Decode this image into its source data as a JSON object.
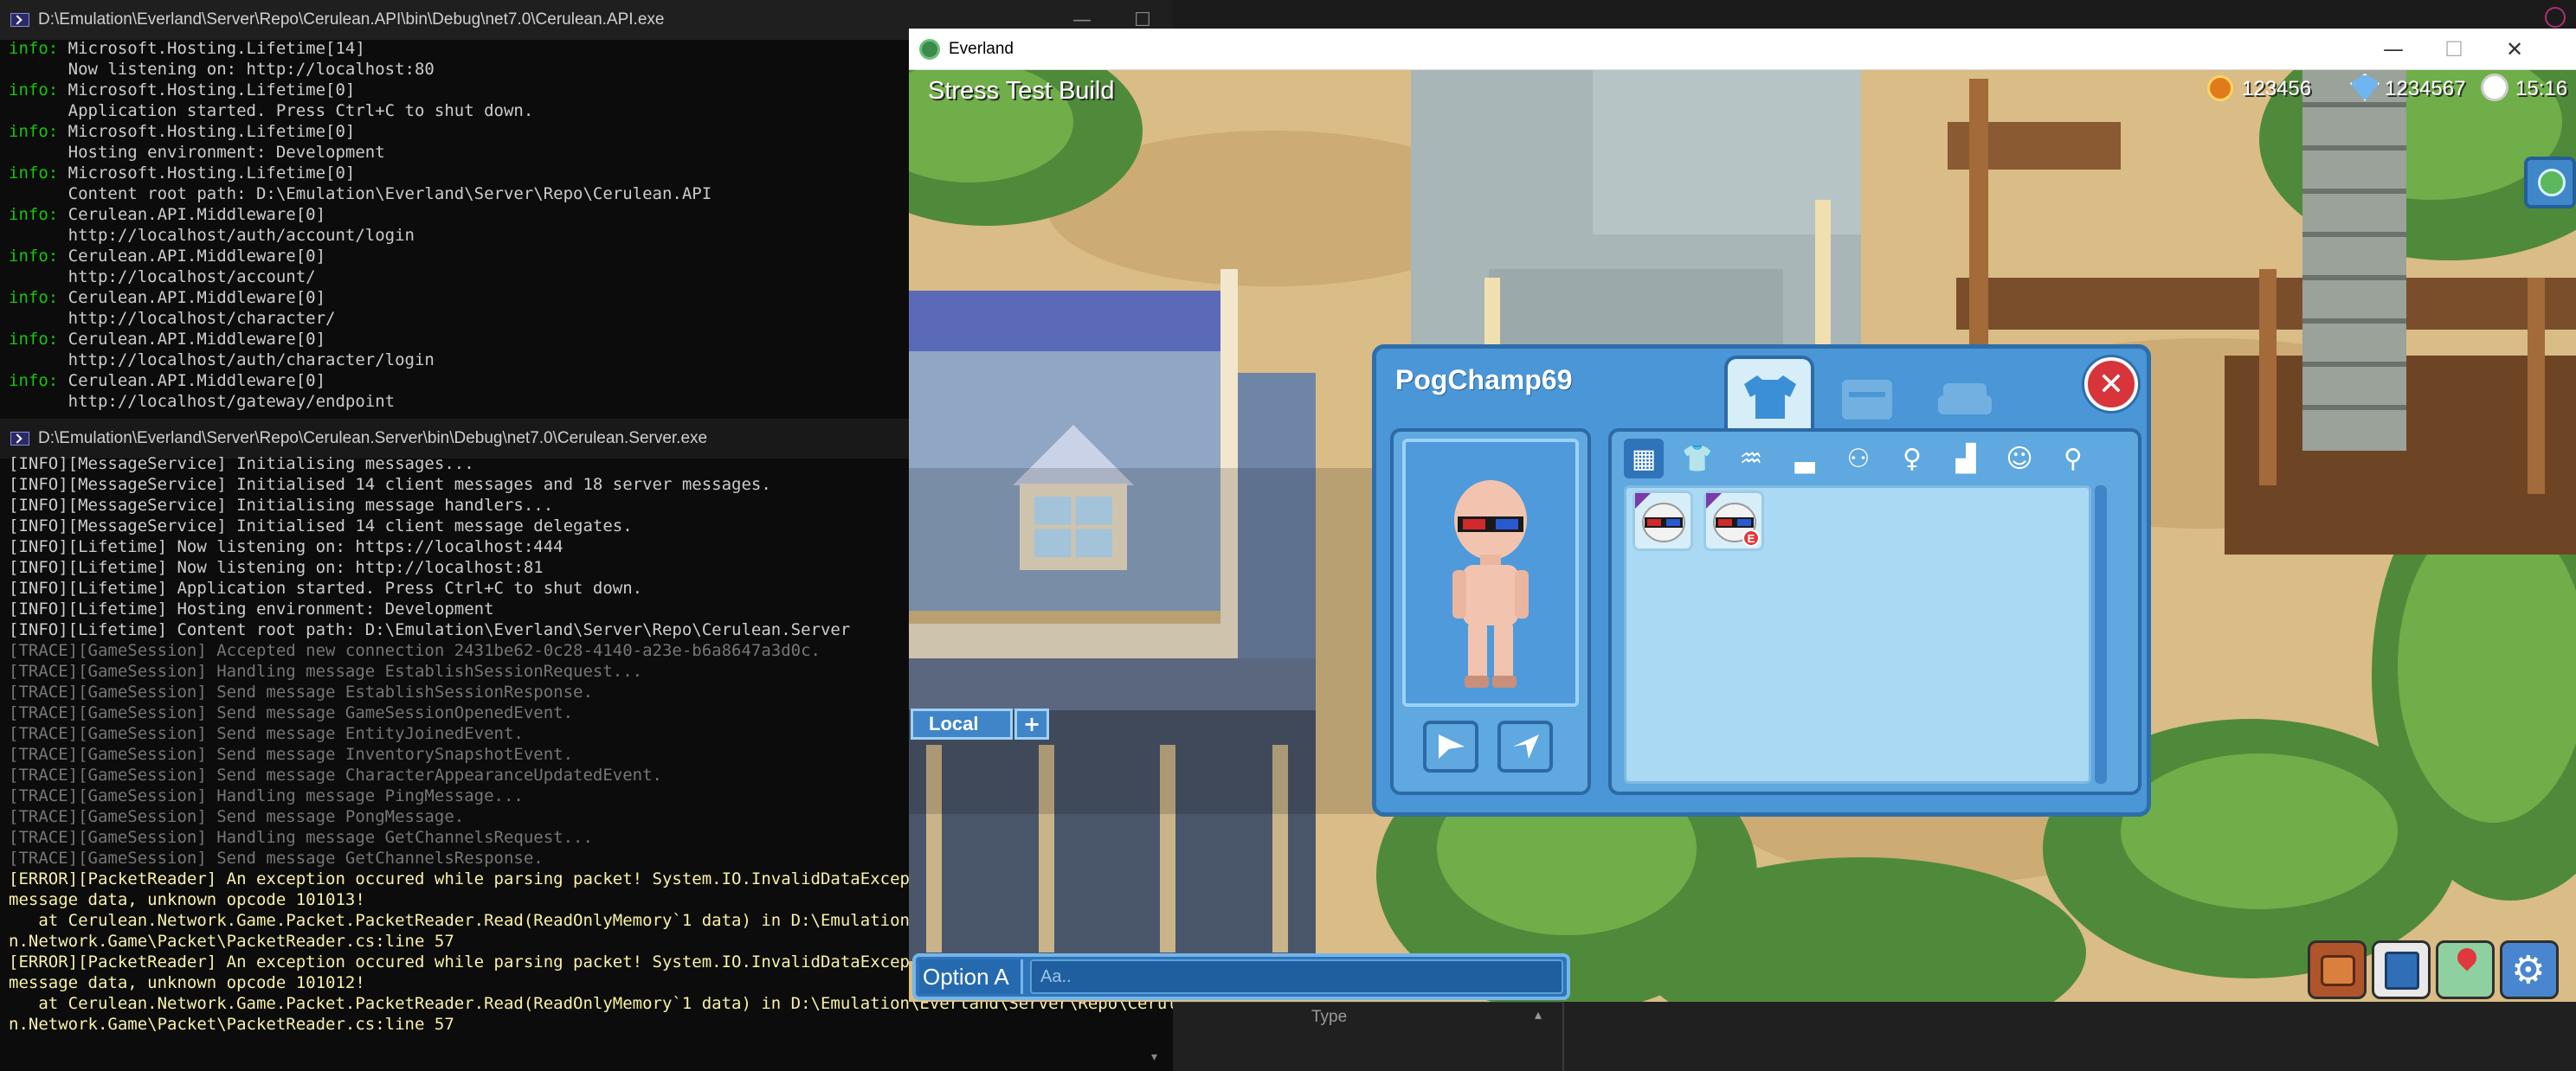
{
  "api_console": {
    "title": "D:\\Emulation\\Everland\\Server\\Repo\\Cerulean.API\\bin\\Debug\\net7.0\\Cerulean.API.exe",
    "lines": [
      {
        "tag": "info:",
        "text": " Microsoft.Hosting.Lifetime[14]"
      },
      {
        "tag": "",
        "text": "      Now listening on: http://localhost:80"
      },
      {
        "tag": "info:",
        "text": " Microsoft.Hosting.Lifetime[0]"
      },
      {
        "tag": "",
        "text": "      Application started. Press Ctrl+C to shut down."
      },
      {
        "tag": "info:",
        "text": " Microsoft.Hosting.Lifetime[0]"
      },
      {
        "tag": "",
        "text": "      Hosting environment: Development"
      },
      {
        "tag": "info:",
        "text": " Microsoft.Hosting.Lifetime[0]"
      },
      {
        "tag": "",
        "text": "      Content root path: D:\\Emulation\\Everland\\Server\\Repo\\Cerulean.API"
      },
      {
        "tag": "info:",
        "text": " Cerulean.API.Middleware[0]"
      },
      {
        "tag": "",
        "text": "      http://localhost/auth/account/login"
      },
      {
        "tag": "info:",
        "text": " Cerulean.API.Middleware[0]"
      },
      {
        "tag": "",
        "text": "      http://localhost/account/"
      },
      {
        "tag": "info:",
        "text": " Cerulean.API.Middleware[0]"
      },
      {
        "tag": "",
        "text": "      http://localhost/character/"
      },
      {
        "tag": "info:",
        "text": " Cerulean.API.Middleware[0]"
      },
      {
        "tag": "",
        "text": "      http://localhost/auth/character/login"
      },
      {
        "tag": "info:",
        "text": " Cerulean.API.Middleware[0]"
      },
      {
        "tag": "",
        "text": "      http://localhost/gateway/endpoint"
      }
    ]
  },
  "server_console": {
    "title": "D:\\Emulation\\Everland\\Server\\Repo\\Cerulean.Server\\bin\\Debug\\net7.0\\Cerulean.Server.exe",
    "lines": [
      {
        "kind": "plain",
        "text": "[INFO][MessageService] Initialising messages..."
      },
      {
        "kind": "plain",
        "text": "[INFO][MessageService] Initialised 14 client messages and 18 server messages."
      },
      {
        "kind": "plain",
        "text": "[INFO][MessageService] Initialising message handlers..."
      },
      {
        "kind": "plain",
        "text": "[INFO][MessageService] Initialised 14 client message delegates."
      },
      {
        "kind": "plain",
        "text": "[INFO][Lifetime] Now listening on: https://localhost:444"
      },
      {
        "kind": "plain",
        "text": "[INFO][Lifetime] Now listening on: http://localhost:81"
      },
      {
        "kind": "plain",
        "text": "[INFO][Lifetime] Application started. Press Ctrl+C to shut down."
      },
      {
        "kind": "plain",
        "text": "[INFO][Lifetime] Hosting environment: Development"
      },
      {
        "kind": "plain",
        "text": "[INFO][Lifetime] Content root path: D:\\Emulation\\Everland\\Server\\Repo\\Cerulean.Server"
      },
      {
        "kind": "trace",
        "text": "[TRACE][GameSession] Accepted new connection 2431be62-0c28-4140-a23e-b6a8647a3d0c."
      },
      {
        "kind": "trace",
        "text": "[TRACE][GameSession] Handling message EstablishSessionRequest..."
      },
      {
        "kind": "trace",
        "text": "[TRACE][GameSession] Send message EstablishSessionResponse."
      },
      {
        "kind": "trace",
        "text": "[TRACE][GameSession] Send message GameSessionOpenedEvent."
      },
      {
        "kind": "trace",
        "text": "[TRACE][GameSession] Send message EntityJoinedEvent."
      },
      {
        "kind": "trace",
        "text": "[TRACE][GameSession] Send message InventorySnapshotEvent."
      },
      {
        "kind": "trace",
        "text": "[TRACE][GameSession] Send message CharacterAppearanceUpdatedEvent."
      },
      {
        "kind": "trace",
        "text": "[TRACE][GameSession] Handling message PingMessage..."
      },
      {
        "kind": "trace",
        "text": "[TRACE][GameSession] Send message PongMessage."
      },
      {
        "kind": "trace",
        "text": "[TRACE][GameSession] Handling message GetChannelsRequest..."
      },
      {
        "kind": "trace",
        "text": "[TRACE][GameSession] Send message GetChannelsResponse."
      },
      {
        "kind": "err",
        "text": "[ERROR][PacketReader] An exception occured while parsing packet! System.IO.InvalidDataException: Invalid"
      },
      {
        "kind": "err",
        "text": "message data, unknown opcode 101013!"
      },
      {
        "kind": "err",
        "text": "   at Cerulean.Network.Game.Packet.PacketReader.Read(ReadOnlyMemory`1 data) in D:\\Emulation\\Everland\\Server\\Repo\\Cerulea"
      },
      {
        "kind": "err",
        "text": "n.Network.Game\\Packet\\PacketReader.cs:line 57"
      },
      {
        "kind": "err",
        "text": "[ERROR][PacketReader] An exception occured while parsing packet! System.IO.InvalidDataException: Invalid"
      },
      {
        "kind": "err",
        "text": "message data, unknown opcode 101012!"
      },
      {
        "kind": "err",
        "text": "   at Cerulean.Network.Game.Packet.PacketReader.Read(ReadOnlyMemory`1 data) in D:\\Emulation\\Everland\\Server\\Repo\\Cerulea"
      },
      {
        "kind": "err",
        "text": "n.Network.Game\\Packet\\PacketReader.cs:line 57"
      }
    ]
  },
  "window_controls": {
    "minimize": "—",
    "maximize": "☐",
    "close": "✕"
  },
  "game_window": {
    "title": "Everland"
  },
  "hud": {
    "build_label": "Stress Test Build",
    "coins": "123456",
    "gems": "1234567",
    "time": "15:16"
  },
  "chat": {
    "channel_label": "Local",
    "add_label": "+",
    "option_label": "Option A",
    "input_placeholder": "Aa.."
  },
  "character_panel": {
    "player_name": "PogChamp69",
    "tabs": [
      "shirt-icon",
      "chest-icon",
      "sofa-icon"
    ],
    "categories": [
      "grid-icon",
      "shirt-icon",
      "outfit-icon",
      "shoes-icon",
      "glasses-icon",
      "hair-icon",
      "hat-icon",
      "face-icon",
      "search-icon"
    ],
    "items": [
      {
        "icon": "3d-glasses-icon",
        "badge": ""
      },
      {
        "icon": "3d-glasses-icon",
        "badge": "E"
      }
    ]
  },
  "background_panel": {
    "column_header": "Type"
  },
  "colors": {
    "info_green": "#16c60c",
    "trace_gray": "#767676",
    "error_yellow": "#f9f1a5",
    "panel_blue": "#4a96d6",
    "panel_border": "#2e6eab",
    "close_red": "#d8343c"
  }
}
